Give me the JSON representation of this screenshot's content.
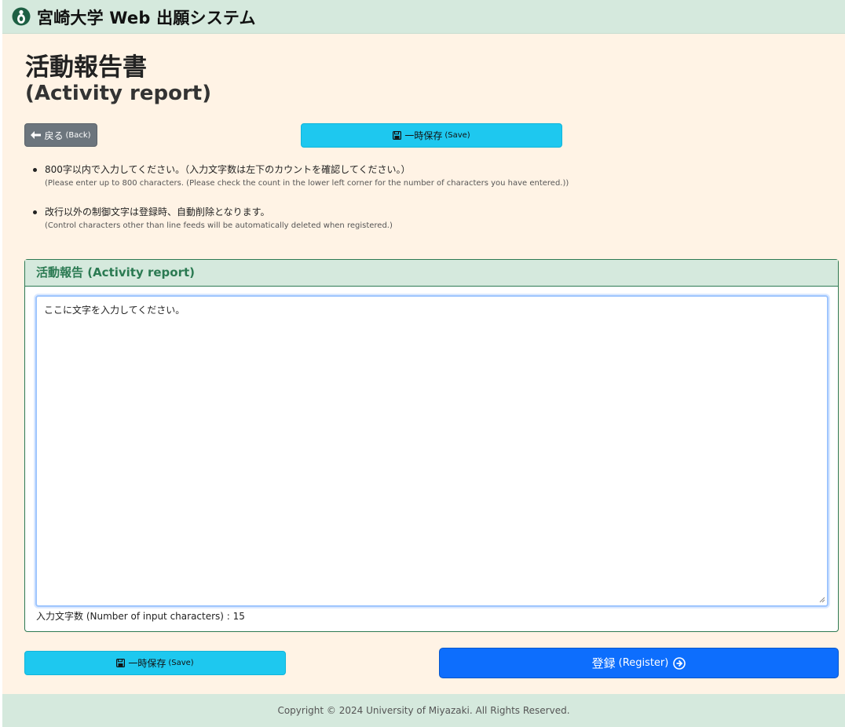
{
  "header": {
    "site_title": "宮崎大学 Web 出願システム",
    "logo_icon": "university-logo-icon"
  },
  "page": {
    "title": "活動報告書",
    "title_en": "(Activity report)"
  },
  "toolbar": {
    "back_label": "戻る",
    "back_label_en": "(Back)",
    "save_label": "一時保存",
    "save_label_en": "(Save)"
  },
  "notes": [
    {
      "jp": "800字以内で入力してください。（入力文字数は左下のカウントを確認してください。）",
      "en": "(Please enter up to 800 characters. (Please check the count in the lower left corner for the number of characters you have entered.))"
    },
    {
      "jp": "改行以外の制御文字は登録時、自動削除となります。",
      "en": "(Control characters other than line feeds will be automatically deleted when registered.)"
    }
  ],
  "activity": {
    "card_title": "活動報告 (Activity report)",
    "text_value": "ここに文字を入力してください。",
    "char_count_label": "入力文字数 (Number of input characters) : 15"
  },
  "register": {
    "label": "登録",
    "label_en": "(Register)"
  },
  "footer": {
    "copyright": "Copyright © 2024 University of Miyazaki. All Rights Reserved."
  },
  "colors": {
    "header_bg": "#d5e9dd",
    "page_bg": "#fff3e5",
    "accent_green": "#2b7a52",
    "save_cyan": "#1ec8ef",
    "register_blue": "#0d6efd",
    "back_gray": "#6c757d"
  }
}
